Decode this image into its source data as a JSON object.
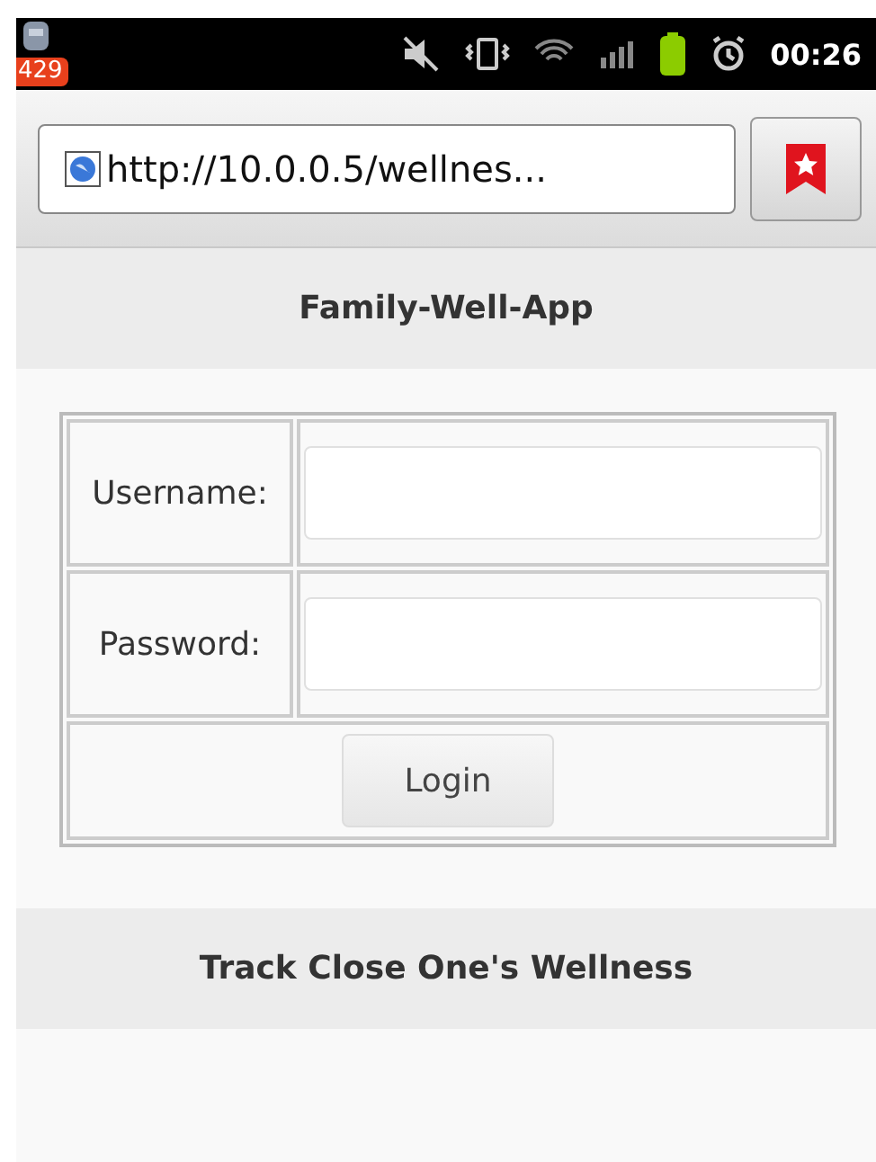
{
  "status_bar": {
    "notification_count": "429",
    "time": "00:26"
  },
  "browser": {
    "url": "http://10.0.0.5/wellnes..."
  },
  "header": {
    "title": "Family-Well-App"
  },
  "login_form": {
    "fields": [
      {
        "label": "Username:"
      },
      {
        "label": "Password:"
      }
    ],
    "button": "Login"
  },
  "footer": {
    "title": "Track Close One's Wellness"
  }
}
